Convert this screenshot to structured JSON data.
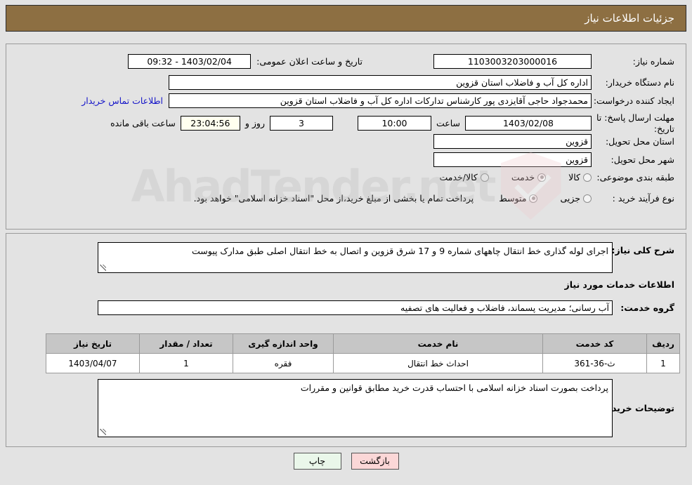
{
  "header": {
    "title": "جزئیات اطلاعات نیاز"
  },
  "top_form": {
    "need_number_label": "شماره نیاز:",
    "need_number_value": "1103003203000016",
    "announce_datetime_label": "تاریخ و ساعت اعلان عمومی:",
    "announce_datetime_value": "1403/02/04 - 09:32",
    "buyer_org_label": "نام دستگاه خریدار:",
    "buyer_org_value": "اداره کل آب و فاضلاب استان قزوین",
    "buyer_org_secondary_value": "",
    "creator_label": "ایجاد کننده درخواست:",
    "creator_value": "محمدجواد حاجی آقایزدی پور کارشناس تدارکات اداره کل آب و فاضلاب استان قزوین",
    "contact_link": "اطلاعات تماس خریدار",
    "deadline_label": "مهلت ارسال پاسخ: تا تاریخ:",
    "deadline_date_value": "1403/02/08",
    "hour_label": "ساعت",
    "deadline_time_value": "10:00",
    "days_value": "3",
    "days_label": "روز و",
    "countdown_value": "23:04:56",
    "remaining_label": "ساعت باقی مانده",
    "province_label": "استان محل تحویل:",
    "province_value": "قزوین",
    "city_label": "شهر محل تحویل:",
    "city_value": "قزوین",
    "category_label": "طبقه بندی موضوعی:",
    "category_options": [
      {
        "label": "کالا",
        "selected": false
      },
      {
        "label": "خدمت",
        "selected": true
      },
      {
        "label": "کالا/خدمت",
        "selected": false
      }
    ],
    "process_label": "نوع فرآیند خرید :",
    "process_options": [
      {
        "label": "جزیی",
        "selected": false
      },
      {
        "label": "متوسط",
        "selected": true
      }
    ],
    "payment_note": "پرداخت تمام یا بخشی از مبلغ خرید،از محل \"اسناد خزانه اسلامی\" خواهد بود."
  },
  "bottom_form": {
    "general_desc_label": "شرح کلی نیاز:",
    "general_desc_value": "اجرای لوله گذاری خط انتقال چاههای شماره  9 و  17 شرق قزوین و اتصال به خط انتقال اصلی طبق مدارک پیوست",
    "services_info_heading": "اطلاعات خدمات مورد نیاز",
    "service_group_label": "گروه خدمت:",
    "service_group_value": "آب رسانی؛ مدیریت پسماند، فاضلاب و فعالیت های تصفیه",
    "table": {
      "columns": [
        "ردیف",
        "کد خدمت",
        "نام خدمت",
        "واحد اندازه گیری",
        "تعداد / مقدار",
        "تاریخ نیاز"
      ],
      "rows": [
        [
          "1",
          "ث-36-361",
          "احداث خط انتقال",
          "فقره",
          "1",
          "1403/04/07"
        ]
      ]
    },
    "buyer_notes_label": "توضیحات خریدار:",
    "buyer_notes_value": "پرداخت بصورت اسناد خزانه اسلامی با احتساب قدرت خرید مطابق قوانین و مقررات"
  },
  "footer": {
    "print_label": "چاپ",
    "back_label": "بازگشت"
  },
  "watermark": {
    "text": "AhadTender.net"
  },
  "colors": {
    "header_bg": "#8d6f42",
    "panel_bg": "#e3e3e3",
    "link": "#1414c8",
    "countdown_bg": "#ffffef",
    "table_header_bg": "#c6c6c6",
    "print_btn_bg": "#eaf7ea",
    "back_btn_bg": "#fbd7d7"
  }
}
